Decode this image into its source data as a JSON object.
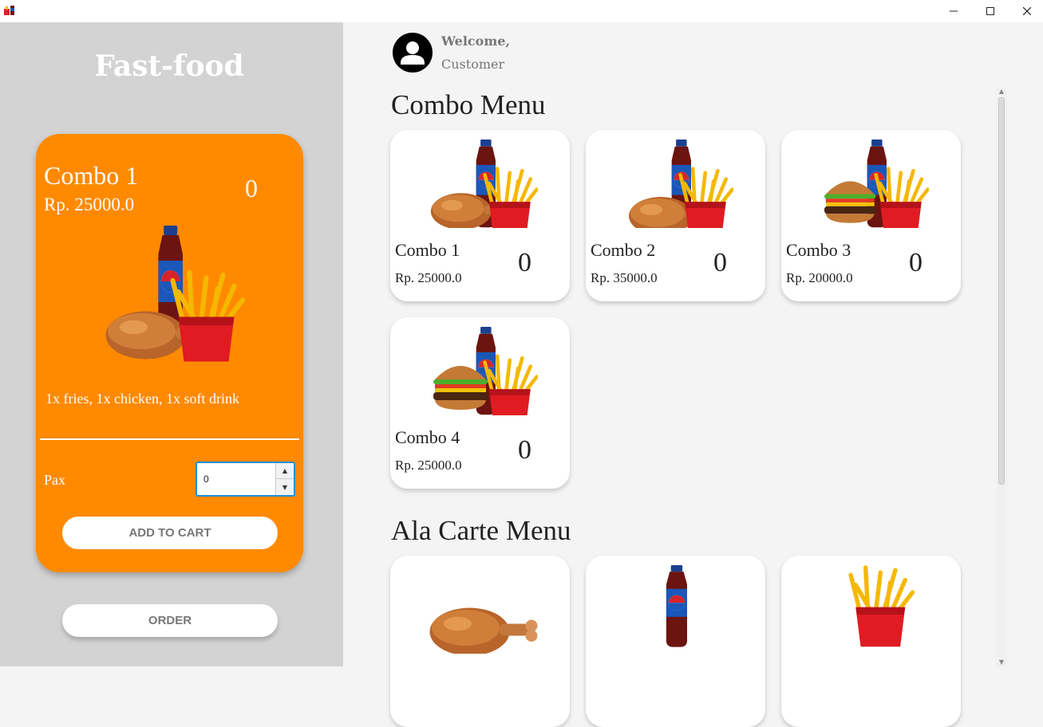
{
  "window": {
    "minimize_icon": "minimize-icon",
    "maximize_icon": "maximize-icon",
    "close_icon": "close-icon"
  },
  "sidebar": {
    "brand": "Fast-food",
    "detail": {
      "name": "Combo 1",
      "price": "Rp. 25000.0",
      "qty": "0",
      "description": "1x fries, 1x chicken, 1x soft drink",
      "pax_label": "Pax",
      "pax_value": "0",
      "add_to_cart": "ADD TO CART"
    },
    "order_button": "ORDER"
  },
  "header": {
    "welcome": "Welcome,",
    "user": "Customer"
  },
  "combo_menu": {
    "title": "Combo Menu",
    "items": [
      {
        "name": "Combo 1",
        "price": "Rp. 25000.0",
        "qty": "0"
      },
      {
        "name": "Combo 2",
        "price": "Rp. 35000.0",
        "qty": "0"
      },
      {
        "name": "Combo 3",
        "price": "Rp. 20000.0",
        "qty": "0"
      },
      {
        "name": "Combo 4",
        "price": "Rp. 25000.0",
        "qty": "0"
      }
    ]
  },
  "ala_carte_menu": {
    "title": "Ala Carte Menu",
    "items": [
      {
        "icon": "chicken-drumstick-image"
      },
      {
        "icon": "soda-bottle-image"
      },
      {
        "icon": "fries-image"
      }
    ]
  },
  "colors": {
    "accent": "#ff8a00",
    "sidebar_bg": "#d3d3d3",
    "main_bg": "#f4f4f4"
  }
}
